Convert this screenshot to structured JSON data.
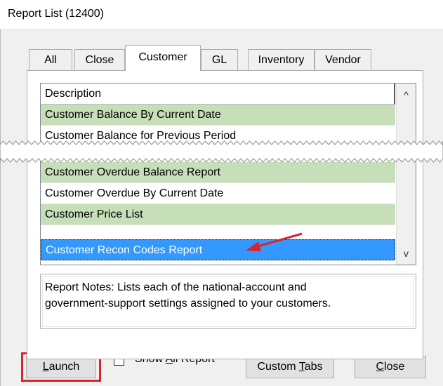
{
  "window": {
    "title": "Report List (12400)"
  },
  "tabs": [
    {
      "label": "All",
      "active": false
    },
    {
      "label": "Close",
      "active": false
    },
    {
      "label": "Customer",
      "active": true
    },
    {
      "label": "GL",
      "active": false
    },
    {
      "label": "Inventory",
      "active": false
    },
    {
      "label": "Vendor",
      "active": false
    }
  ],
  "list": {
    "column_header": "Description",
    "rows_top": [
      {
        "label": "Customer Balance By Current Date"
      },
      {
        "label": "Customer Balance for Previous Period"
      }
    ],
    "rows_bottom": [
      {
        "label": "Customer Overdue Balance Report"
      },
      {
        "label": "Customer Overdue By Current Date"
      },
      {
        "label": "Customer Price List"
      },
      {
        "label": "Customer Recon Codes Report",
        "selected": true
      }
    ],
    "scroll_up": "^",
    "scroll_down": "v"
  },
  "notes": {
    "line1": "Report Notes:  Lists each of the national-account and",
    "line2": "government-support settings assigned to your customers."
  },
  "footer": {
    "launch": {
      "pre": "",
      "u": "L",
      "post": "aunch"
    },
    "show_all": {
      "pre": "Show ",
      "u": "A",
      "post": "ll Report",
      "checked": false
    },
    "custom_tabs": {
      "pre": "Custom ",
      "u": "T",
      "post": "abs"
    },
    "close": {
      "pre": "",
      "u": "C",
      "post": "lose"
    }
  },
  "colors": {
    "row_green": "#c6dfb9",
    "selected_row": "#3399ff",
    "callout_arrow": "#d9232d",
    "launch_highlight": "#d9232d"
  }
}
